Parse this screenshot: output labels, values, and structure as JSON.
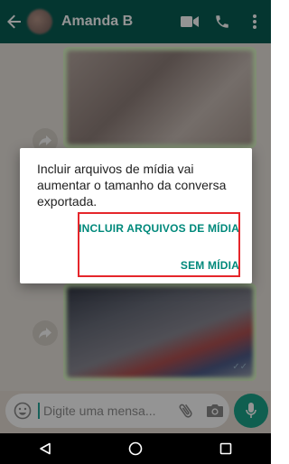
{
  "header": {
    "contact_name": "Amanda B",
    "background": "#075e54",
    "icons": [
      "back-arrow-icon",
      "avatar",
      "video-call-icon",
      "phone-icon",
      "more-vertical-icon"
    ]
  },
  "chat": {
    "background": "#e5ddd5",
    "bubble_color": "#dcf8c6"
  },
  "dialog": {
    "message": "Incluir arquivos de mídia vai aumentar o tamanho da conversa exportada.",
    "include_media_label": "INCLUIR ARQUIVOS DE MÍDIA",
    "without_media_label": "SEM MÍDIA",
    "accent_color": "#00897b",
    "highlight_color": "#e5262b"
  },
  "composer": {
    "placeholder": "Digite uma mensa...",
    "icons": [
      "emoji-icon",
      "attach-icon",
      "camera-icon",
      "mic-icon"
    ],
    "mic_color": "#1aa48a"
  },
  "nav": {
    "icons": [
      "back-triangle-icon",
      "home-circle-icon",
      "recents-square-icon"
    ]
  }
}
